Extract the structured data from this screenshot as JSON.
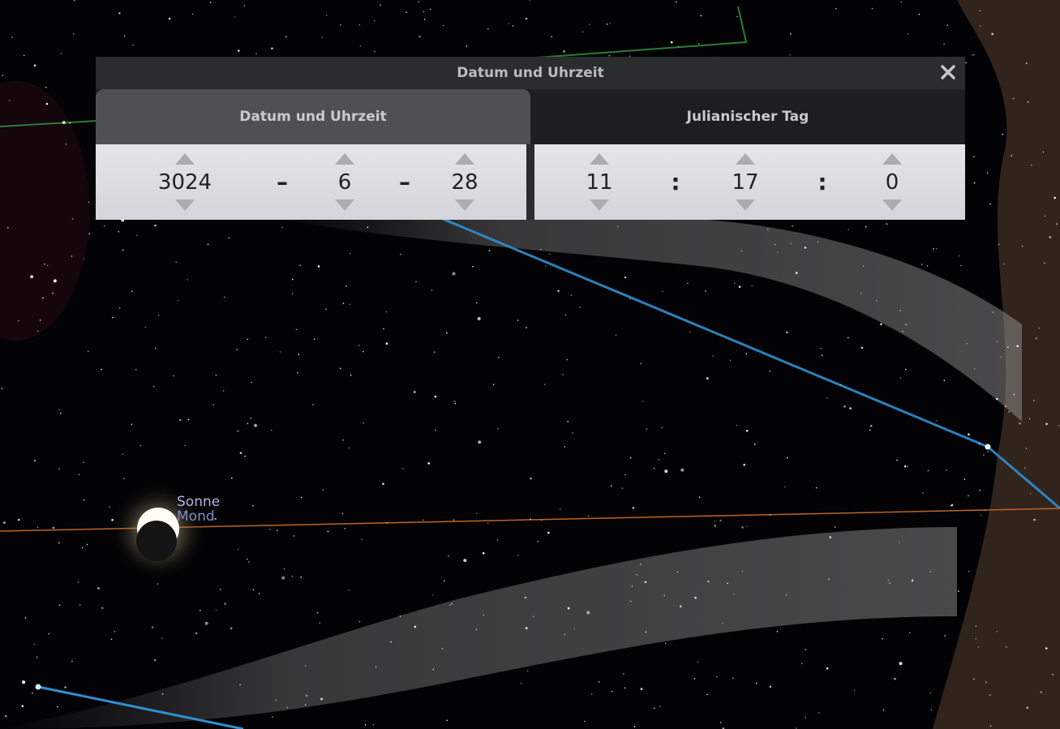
{
  "dialog": {
    "title": "Datum und Uhrzeit",
    "close_icon": "close-icon"
  },
  "tabs": [
    {
      "label": "Datum und Uhrzeit",
      "active": true
    },
    {
      "label": "Julianischer Tag",
      "active": false
    }
  ],
  "date": {
    "year": "3024",
    "separator": "–",
    "month": "6",
    "day": "28"
  },
  "time": {
    "hour": "11",
    "separator": ":",
    "minute": "17",
    "second": "0"
  },
  "sky_labels": {
    "sun": "Sonne",
    "moon": "Mond"
  },
  "colors": {
    "constellation_line": "#2f8fd0",
    "ecliptic_line": "#c0641f",
    "boundary_line": "#2c7a3a",
    "sun_label": "#b7b3e6",
    "moon_label": "#8d8ac4"
  }
}
